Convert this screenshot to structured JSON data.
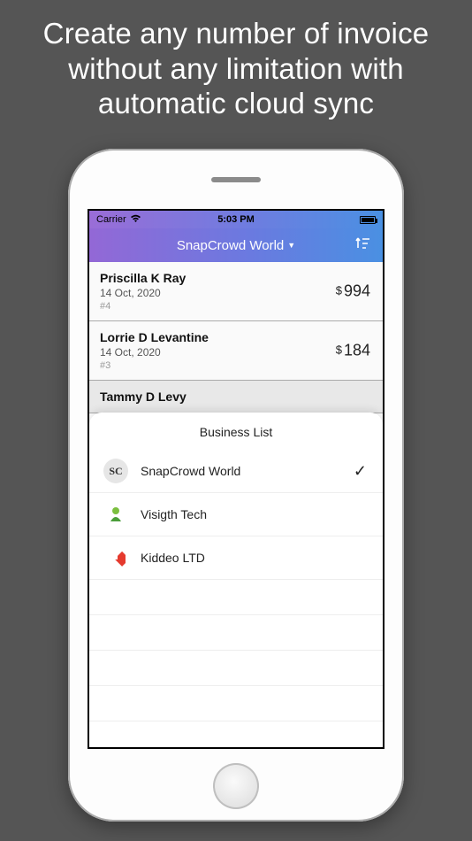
{
  "promo": {
    "line1": "Create any number of invoice",
    "line2": "without any limitation with",
    "line3": "automatic cloud sync"
  },
  "status_bar": {
    "carrier": "Carrier",
    "time": "5:03 PM"
  },
  "nav": {
    "title": "SnapCrowd World"
  },
  "invoices": [
    {
      "name": "Priscilla K Ray",
      "date": "14 Oct, 2020",
      "id": "#4",
      "currency": "$",
      "amount": "994"
    },
    {
      "name": "Lorrie D Levantine",
      "date": "14 Oct, 2020",
      "id": "#3",
      "currency": "$",
      "amount": "184"
    },
    {
      "name": "Tammy D Levy",
      "date": "",
      "id": "",
      "currency": "",
      "amount": ""
    }
  ],
  "sheet": {
    "title": "Business List",
    "items": [
      {
        "name": "SnapCrowd World",
        "selected": true
      },
      {
        "name": "Visigth Tech",
        "selected": false
      },
      {
        "name": "Kiddeo LTD",
        "selected": false
      }
    ]
  }
}
